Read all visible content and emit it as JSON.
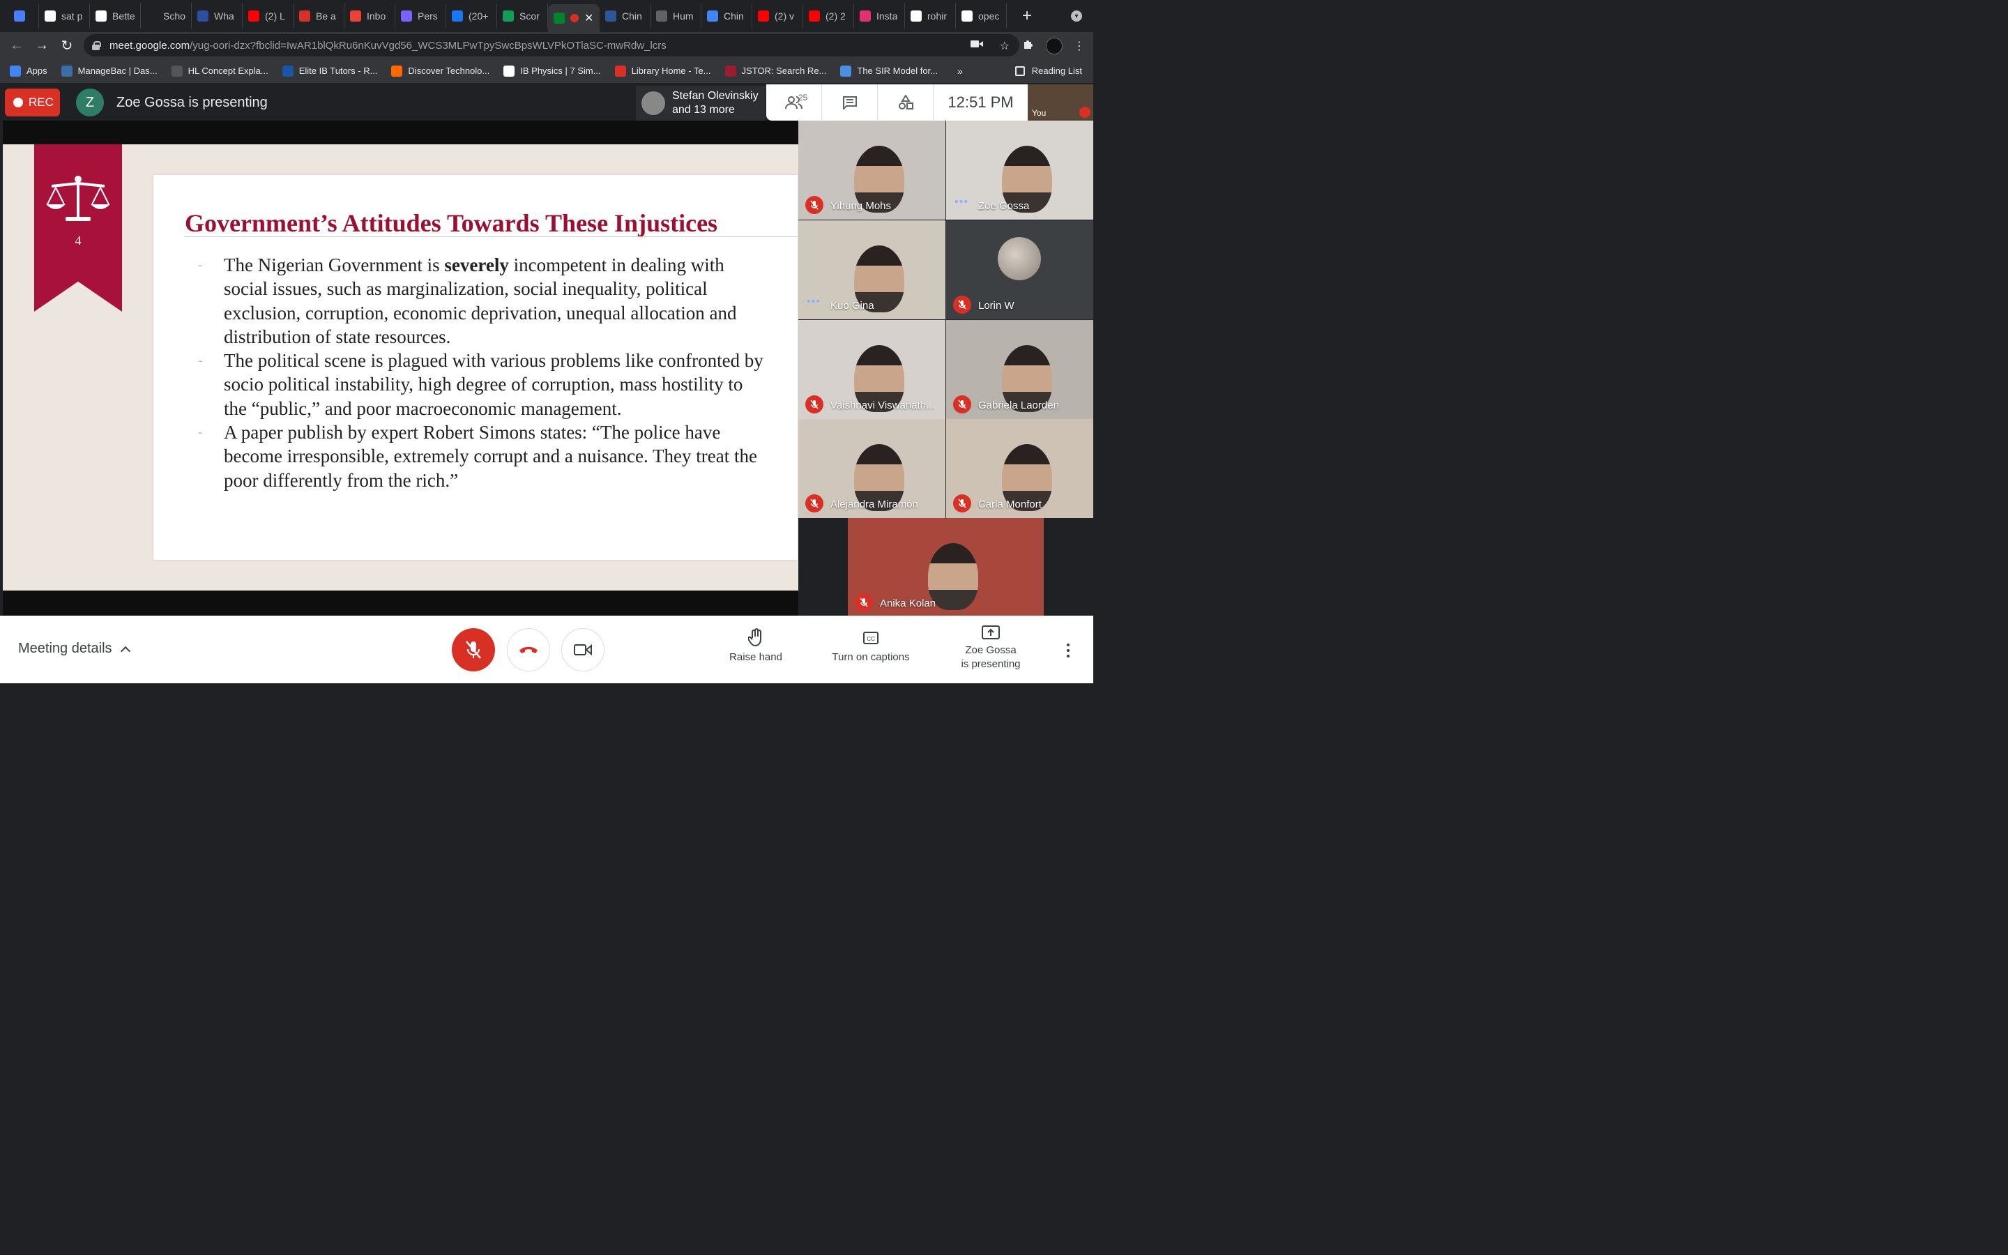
{
  "browser": {
    "tabs": [
      {
        "label": "",
        "icon": "vpn-shield-icon",
        "color": "#4a7dff"
      },
      {
        "label": "sat p",
        "icon": "google-icon",
        "color": "#ffffff"
      },
      {
        "label": "Bette",
        "icon": "p-logo-icon",
        "color": "#ffffff"
      },
      {
        "label": "Scho",
        "icon": "bars-logo-icon",
        "color": "#202124"
      },
      {
        "label": "Wha",
        "icon": "loa-logo-icon",
        "color": "#2c4fa3"
      },
      {
        "label": "(2) L",
        "icon": "youtube-icon",
        "color": "#ff0000"
      },
      {
        "label": "Be a",
        "icon": "thermometer-icon",
        "color": "#d93025"
      },
      {
        "label": "Inbo",
        "icon": "gmail-icon",
        "color": "#ea4335"
      },
      {
        "label": "Pers",
        "icon": "list-icon",
        "color": "#7b61ff"
      },
      {
        "label": "(20+",
        "icon": "facebook-icon",
        "color": "#1877f2"
      },
      {
        "label": "Scor",
        "icon": "sheets-icon",
        "color": "#0f9d58"
      },
      {
        "label": "",
        "icon": "meet-icon",
        "color": "#00832d",
        "active": true
      },
      {
        "label": "Chin",
        "icon": "word-icon",
        "color": "#2b579a"
      },
      {
        "label": "Hum",
        "icon": "globe-icon",
        "color": "#5f6368"
      },
      {
        "label": "Chin",
        "icon": "g-logo-icon",
        "color": "#4285f4"
      },
      {
        "label": "(2) v",
        "icon": "youtube-icon",
        "color": "#ff0000"
      },
      {
        "label": "(2) 2",
        "icon": "youtube-icon",
        "color": "#ff0000"
      },
      {
        "label": "Insta",
        "icon": "instagram-icon",
        "color": "#e1306c"
      },
      {
        "label": "rohir",
        "icon": "google-icon",
        "color": "#ffffff"
      },
      {
        "label": "opec",
        "icon": "google-icon",
        "color": "#ffffff"
      }
    ],
    "url_host": "meet.google.com",
    "url_path": "/yug-oori-dzx?fbclid=IwAR1blQkRu6nKuvVgd56_WCS3MLPwTpySwcBpsWLVPkOTlaSC-mwRdw_lcrs",
    "bookmarks": [
      {
        "label": "Apps",
        "icon": "apps-grid-icon",
        "color": "#4285f4"
      },
      {
        "label": "ManageBac | Das...",
        "icon": "managebac-icon",
        "color": "#3a6ea5"
      },
      {
        "label": "HL Concept Expla...",
        "icon": "p-icon",
        "color": "#555555"
      },
      {
        "label": "Elite IB Tutors - R...",
        "icon": "elite-icon",
        "color": "#1a56a8"
      },
      {
        "label": "Discover Technolo...",
        "icon": "ring-icon",
        "color": "#ff6a00"
      },
      {
        "label": "IB Physics | 7 Sim...",
        "icon": "ib-icon",
        "color": "#ffffff"
      },
      {
        "label": "Library Home - Te...",
        "icon": "library-icon",
        "color": "#d93025"
      },
      {
        "label": "JSTOR: Search Re...",
        "icon": "jstor-icon",
        "color": "#9b1b30"
      },
      {
        "label": "The SIR Model for...",
        "icon": "globe-icon",
        "color": "#4a90e2"
      }
    ],
    "bookmarks_more": "»",
    "reading_list": "Reading List"
  },
  "meet": {
    "rec_label": "REC",
    "presenter_initial": "Z",
    "presenting_text": "Zoe Gossa is presenting",
    "speaker_line1": "Stefan Olevinskiy",
    "speaker_line2": "and 13 more",
    "participant_count": "25",
    "time": "12:51 PM",
    "self_label": "You"
  },
  "slide": {
    "number": "4",
    "title": "Government’s Attitudes Towards These Injustices",
    "bullet1_pre": "The Nigerian Government is ",
    "bullet1_bold": "severely",
    "bullet1_post": " incompetent in dealing with social issues, such as marginalization, social inequality, political exclusion, corruption, economic deprivation, unequal allocation and distribution of state resources.",
    "bullet2": "The political scene is plagued with various problems like confronted by socio political instability, high degree of corruption, mass hostility to the “public,” and poor macroeconomic management.",
    "bullet3": "A paper publish by expert Robert Simons states: “The police have become irresponsible, extremely corrupt and a nuisance. They treat the poor differently from the rich.”"
  },
  "participants": [
    {
      "name": "Yihung Mohs",
      "status": "muted",
      "bg": "#c9c3bf"
    },
    {
      "name": "Zoe Gossa",
      "status": "speaking",
      "bg": "#d8d4d0"
    },
    {
      "name": "Kuo Gina",
      "status": "speaking",
      "bg": "#cfc9bd"
    },
    {
      "name": "Lorin W",
      "status": "muted",
      "bg": "#3c4043"
    },
    {
      "name": "Vaishnavi Viswanath...",
      "status": "muted",
      "bg": "#d6d1cd"
    },
    {
      "name": "Gabriela Laorden",
      "status": "muted",
      "bg": "#b9b3ad"
    },
    {
      "name": "Alejandra Miramón",
      "status": "muted",
      "bg": "#cfc6bc"
    },
    {
      "name": "Carla Monfort",
      "status": "muted",
      "bg": "#cdc2b4"
    },
    {
      "name": "Anika Kolan",
      "status": "muted",
      "bg": "#a8483d"
    }
  ],
  "bottom_bar": {
    "meeting_details": "Meeting details",
    "raise_hand": "Raise hand",
    "captions": "Turn on captions",
    "presenting_line1": "Zoe Gossa",
    "presenting_line2": "is presenting"
  }
}
